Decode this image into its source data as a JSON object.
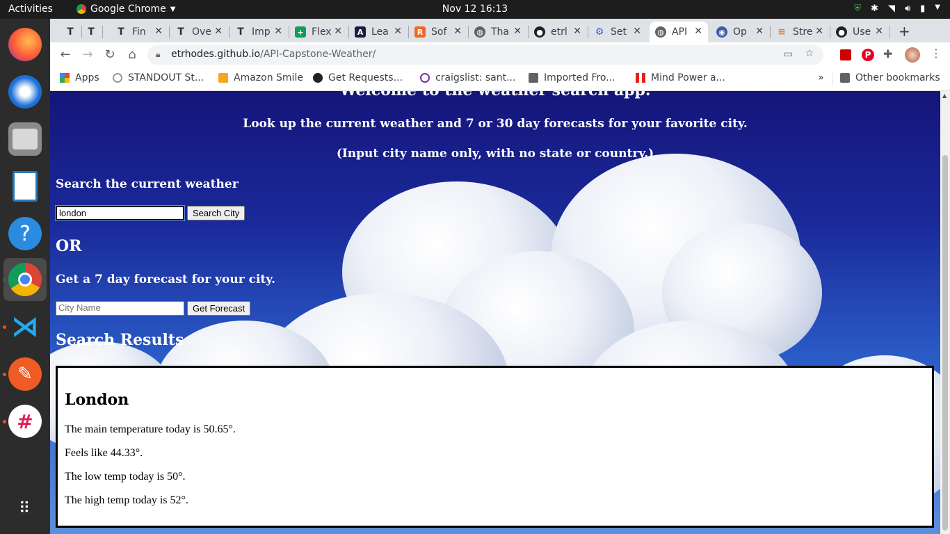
{
  "topbar": {
    "activities": "Activities",
    "app_name": "Google Chrome",
    "clock": "Nov 12  16:13"
  },
  "tabs": [
    {
      "label": "",
      "icon": "typora-icon"
    },
    {
      "label": "",
      "icon": "typora-icon"
    },
    {
      "label": "Fin",
      "icon": "typora-icon"
    },
    {
      "label": "Ove",
      "icon": "typora-icon"
    },
    {
      "label": "Imp",
      "icon": "typora-icon"
    },
    {
      "label": "Flex",
      "icon": "sheets-icon"
    },
    {
      "label": "Lea",
      "icon": "learn-icon"
    },
    {
      "label": "Sof",
      "icon": "r-icon"
    },
    {
      "label": "Tha",
      "icon": "globe-icon"
    },
    {
      "label": "etrl",
      "icon": "github-icon"
    },
    {
      "label": "Set",
      "icon": "gear-icon"
    },
    {
      "label": "API",
      "icon": "globe-icon",
      "active": true
    },
    {
      "label": "Op",
      "icon": "openapi-icon"
    },
    {
      "label": "Stre",
      "icon": "stackoverflow-icon"
    },
    {
      "label": "Use",
      "icon": "github-icon"
    }
  ],
  "address": {
    "domain": "etrhodes.github.io",
    "path": "/API-Capstone-Weather/"
  },
  "bookmarks": [
    {
      "label": "Apps"
    },
    {
      "label": "STANDOUT St..."
    },
    {
      "label": "Amazon Smile"
    },
    {
      "label": "Get Requests..."
    },
    {
      "label": "craigslist: sant..."
    },
    {
      "label": "Imported Fro..."
    },
    {
      "label": "Mind Power a..."
    }
  ],
  "bookmarks_more": "»",
  "other_bookmarks": "Other bookmarks",
  "page": {
    "welcome": "Welcome to the weather search app.",
    "intro": "Look up the current weather and 7 or 30 day forecasts for your favorite city.",
    "instructions": "(Input city name only, with no state or country.)",
    "current_heading": "Search the current weather",
    "current_input_value": "london",
    "search_button": "Search City",
    "or_label": "OR",
    "forecast_heading": "Get a 7 day forecast for your city.",
    "forecast_placeholder": "City Name",
    "forecast_button": "Get Forecast",
    "results_heading": "Search Results"
  },
  "results": {
    "city": "London",
    "main_temp": "The main temperature today is 50.65°.",
    "feels_like": "Feels like 44.33°.",
    "low_temp": "The low temp today is 50°.",
    "high_temp": "The high temp today is 52°."
  }
}
